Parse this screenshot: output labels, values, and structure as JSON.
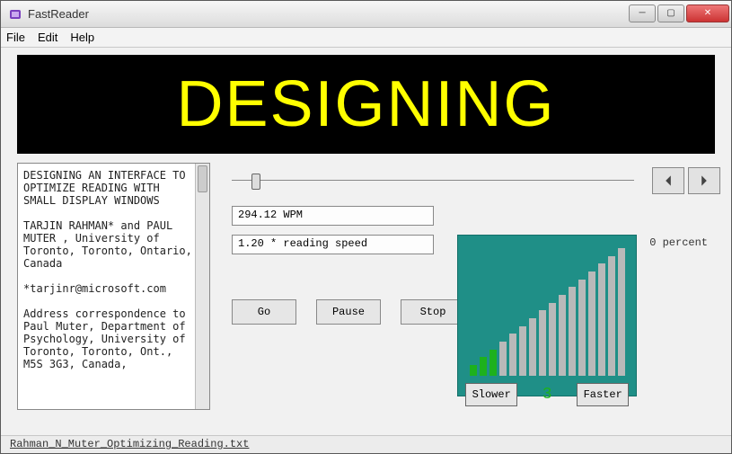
{
  "window": {
    "title": "FastReader"
  },
  "menu": {
    "file": "File",
    "edit": "Edit",
    "help": "Help"
  },
  "display": {
    "word": "DESIGNING"
  },
  "source_text": "DESIGNING AN INTERFACE TO\nOPTIMIZE READING WITH\nSMALL DISPLAY WINDOWS\n\nTARJIN RAHMAN* and PAUL\nMUTER , University of\nToronto, Toronto, Ontario,\nCanada\n\n*tarjinr@microsoft.com\n\nAddress correspondence to\nPaul Muter, Department of\nPsychology, University of\nToronto, Toronto, Ont.,\nM5S 3G3, Canada,",
  "stats": {
    "wpm": "294.12 WPM",
    "factor": "1.20 * reading speed"
  },
  "buttons": {
    "go": "Go",
    "pause": "Pause",
    "stop": "Stop"
  },
  "speed": {
    "percent": "0 percent",
    "slower": "Slower",
    "faster": "Faster",
    "level": "3",
    "bars_total": 16,
    "bars_active": 3
  },
  "status": {
    "filename": "Rahman_N_Muter_Optimizing_Reading.txt"
  },
  "colors": {
    "display_bg": "#000000",
    "display_fg": "#ffff00",
    "speedbox": "#1f8f87",
    "bar_active": "#1db11d",
    "bar_idle": "#b9b9b9"
  }
}
